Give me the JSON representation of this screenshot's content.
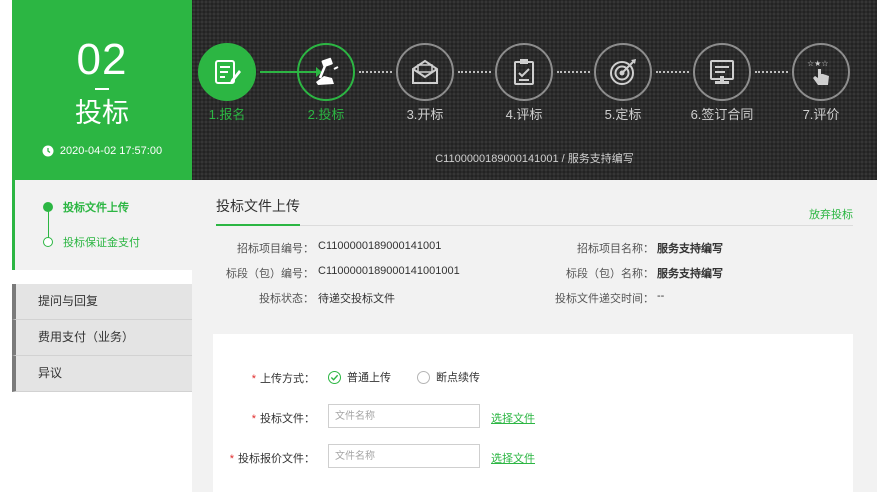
{
  "stage": {
    "number": "02",
    "name": "投标",
    "datetime": "2020-04-02 17:57:00"
  },
  "steps": [
    {
      "label": "1.报名",
      "status": "done",
      "icon": "signup-form-icon"
    },
    {
      "label": "2.投标",
      "status": "active",
      "icon": "bid-hammer-icon"
    },
    {
      "label": "3.开标",
      "status": "pending",
      "icon": "open-envelope-icon"
    },
    {
      "label": "4.评标",
      "status": "pending",
      "icon": "evaluate-clipboard-icon"
    },
    {
      "label": "5.定标",
      "status": "pending",
      "icon": "target-icon"
    },
    {
      "label": "6.签订合同",
      "status": "pending",
      "icon": "contract-sign-icon"
    },
    {
      "label": "7.评价",
      "status": "pending",
      "icon": "rating-stars-icon"
    }
  ],
  "project_path": "C1100000189000141001 / 服务支持编写",
  "sidebar": {
    "sub_items": [
      {
        "label": "投标文件上传",
        "active": true
      },
      {
        "label": "投标保证金支付",
        "active": false
      }
    ],
    "menu": [
      {
        "label": "提问与回复"
      },
      {
        "label": "费用支付（业务）"
      },
      {
        "label": "异议"
      }
    ]
  },
  "main": {
    "title": "投标文件上传",
    "abandon_label": "放弃投标",
    "info": {
      "project_no_label": "招标项目编号：",
      "project_no": "C1100000189000141001",
      "project_name_label": "招标项目名称：",
      "project_name": "服务支持编写",
      "section_no_label": "标段（包）编号：",
      "section_no": "C1100000189000141001001",
      "section_name_label": "标段（包）名称：",
      "section_name": "服务支持编写",
      "status_label": "投标状态：",
      "status": "待递交投标文件",
      "submit_time_label": "投标文件递交时间：",
      "submit_time": "--"
    },
    "form": {
      "required_mark": "*",
      "upload_mode_label": "上传方式：",
      "upload_mode_options": [
        "普通上传",
        "断点续传"
      ],
      "upload_mode_selected": "普通上传",
      "bid_file_label": "投标文件：",
      "bid_file_placeholder": "文件名称",
      "bid_file_choose": "选择文件",
      "quote_file_label": "投标报价文件：",
      "quote_file_placeholder": "文件名称",
      "quote_file_choose": "选择文件"
    }
  },
  "colors": {
    "accent": "#2cb643",
    "banner_bg": "#2b2b2b",
    "required": "#e02b2b"
  }
}
